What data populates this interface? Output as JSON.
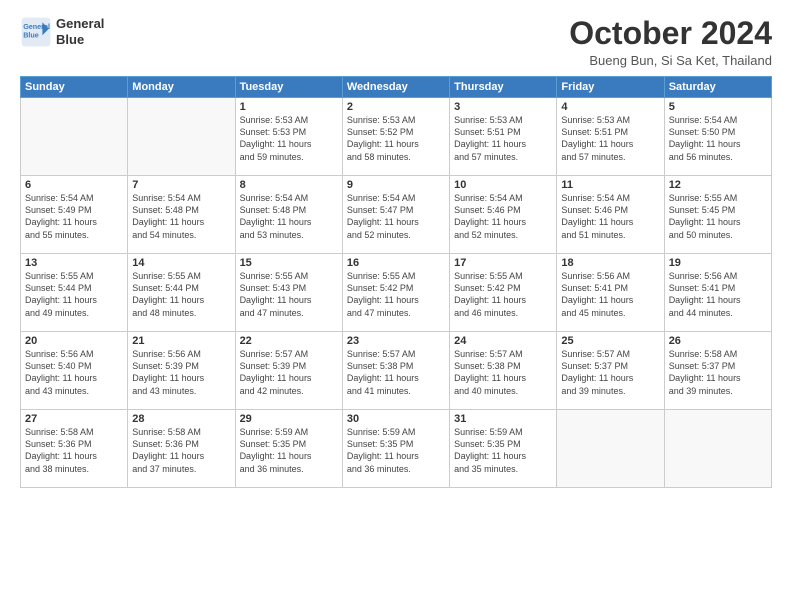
{
  "logo": {
    "line1": "General",
    "line2": "Blue"
  },
  "title": "October 2024",
  "subtitle": "Bueng Bun, Si Sa Ket, Thailand",
  "weekdays": [
    "Sunday",
    "Monday",
    "Tuesday",
    "Wednesday",
    "Thursday",
    "Friday",
    "Saturday"
  ],
  "weeks": [
    [
      {
        "day": "",
        "info": ""
      },
      {
        "day": "",
        "info": ""
      },
      {
        "day": "1",
        "info": "Sunrise: 5:53 AM\nSunset: 5:53 PM\nDaylight: 11 hours\nand 59 minutes."
      },
      {
        "day": "2",
        "info": "Sunrise: 5:53 AM\nSunset: 5:52 PM\nDaylight: 11 hours\nand 58 minutes."
      },
      {
        "day": "3",
        "info": "Sunrise: 5:53 AM\nSunset: 5:51 PM\nDaylight: 11 hours\nand 57 minutes."
      },
      {
        "day": "4",
        "info": "Sunrise: 5:53 AM\nSunset: 5:51 PM\nDaylight: 11 hours\nand 57 minutes."
      },
      {
        "day": "5",
        "info": "Sunrise: 5:54 AM\nSunset: 5:50 PM\nDaylight: 11 hours\nand 56 minutes."
      }
    ],
    [
      {
        "day": "6",
        "info": "Sunrise: 5:54 AM\nSunset: 5:49 PM\nDaylight: 11 hours\nand 55 minutes."
      },
      {
        "day": "7",
        "info": "Sunrise: 5:54 AM\nSunset: 5:48 PM\nDaylight: 11 hours\nand 54 minutes."
      },
      {
        "day": "8",
        "info": "Sunrise: 5:54 AM\nSunset: 5:48 PM\nDaylight: 11 hours\nand 53 minutes."
      },
      {
        "day": "9",
        "info": "Sunrise: 5:54 AM\nSunset: 5:47 PM\nDaylight: 11 hours\nand 52 minutes."
      },
      {
        "day": "10",
        "info": "Sunrise: 5:54 AM\nSunset: 5:46 PM\nDaylight: 11 hours\nand 52 minutes."
      },
      {
        "day": "11",
        "info": "Sunrise: 5:54 AM\nSunset: 5:46 PM\nDaylight: 11 hours\nand 51 minutes."
      },
      {
        "day": "12",
        "info": "Sunrise: 5:55 AM\nSunset: 5:45 PM\nDaylight: 11 hours\nand 50 minutes."
      }
    ],
    [
      {
        "day": "13",
        "info": "Sunrise: 5:55 AM\nSunset: 5:44 PM\nDaylight: 11 hours\nand 49 minutes."
      },
      {
        "day": "14",
        "info": "Sunrise: 5:55 AM\nSunset: 5:44 PM\nDaylight: 11 hours\nand 48 minutes."
      },
      {
        "day": "15",
        "info": "Sunrise: 5:55 AM\nSunset: 5:43 PM\nDaylight: 11 hours\nand 47 minutes."
      },
      {
        "day": "16",
        "info": "Sunrise: 5:55 AM\nSunset: 5:42 PM\nDaylight: 11 hours\nand 47 minutes."
      },
      {
        "day": "17",
        "info": "Sunrise: 5:55 AM\nSunset: 5:42 PM\nDaylight: 11 hours\nand 46 minutes."
      },
      {
        "day": "18",
        "info": "Sunrise: 5:56 AM\nSunset: 5:41 PM\nDaylight: 11 hours\nand 45 minutes."
      },
      {
        "day": "19",
        "info": "Sunrise: 5:56 AM\nSunset: 5:41 PM\nDaylight: 11 hours\nand 44 minutes."
      }
    ],
    [
      {
        "day": "20",
        "info": "Sunrise: 5:56 AM\nSunset: 5:40 PM\nDaylight: 11 hours\nand 43 minutes."
      },
      {
        "day": "21",
        "info": "Sunrise: 5:56 AM\nSunset: 5:39 PM\nDaylight: 11 hours\nand 43 minutes."
      },
      {
        "day": "22",
        "info": "Sunrise: 5:57 AM\nSunset: 5:39 PM\nDaylight: 11 hours\nand 42 minutes."
      },
      {
        "day": "23",
        "info": "Sunrise: 5:57 AM\nSunset: 5:38 PM\nDaylight: 11 hours\nand 41 minutes."
      },
      {
        "day": "24",
        "info": "Sunrise: 5:57 AM\nSunset: 5:38 PM\nDaylight: 11 hours\nand 40 minutes."
      },
      {
        "day": "25",
        "info": "Sunrise: 5:57 AM\nSunset: 5:37 PM\nDaylight: 11 hours\nand 39 minutes."
      },
      {
        "day": "26",
        "info": "Sunrise: 5:58 AM\nSunset: 5:37 PM\nDaylight: 11 hours\nand 39 minutes."
      }
    ],
    [
      {
        "day": "27",
        "info": "Sunrise: 5:58 AM\nSunset: 5:36 PM\nDaylight: 11 hours\nand 38 minutes."
      },
      {
        "day": "28",
        "info": "Sunrise: 5:58 AM\nSunset: 5:36 PM\nDaylight: 11 hours\nand 37 minutes."
      },
      {
        "day": "29",
        "info": "Sunrise: 5:59 AM\nSunset: 5:35 PM\nDaylight: 11 hours\nand 36 minutes."
      },
      {
        "day": "30",
        "info": "Sunrise: 5:59 AM\nSunset: 5:35 PM\nDaylight: 11 hours\nand 36 minutes."
      },
      {
        "day": "31",
        "info": "Sunrise: 5:59 AM\nSunset: 5:35 PM\nDaylight: 11 hours\nand 35 minutes."
      },
      {
        "day": "",
        "info": ""
      },
      {
        "day": "",
        "info": ""
      }
    ]
  ]
}
